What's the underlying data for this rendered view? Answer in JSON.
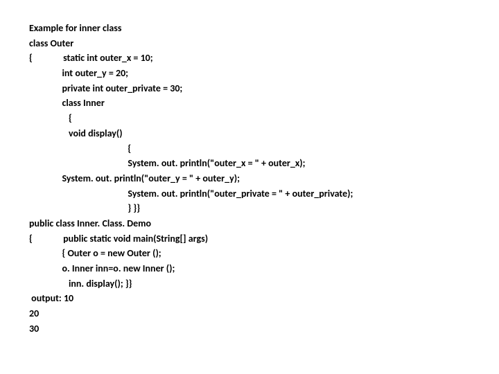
{
  "lines": [
    {
      "text": "Example for inner class",
      "indent": 0
    },
    {
      "text": "class Outer",
      "indent": 0
    },
    {
      "prefix": "{",
      "text": "static int outer_x = 10;",
      "indent": 1
    },
    {
      "text": "int outer_y = 20;",
      "indent": 1
    },
    {
      "text": "private int outer_private = 30;",
      "indent": 1
    },
    {
      "text": "class Inner",
      "indent": 1
    },
    {
      "text": "   {",
      "indent": 1
    },
    {
      "text": "   void display()",
      "indent": 1
    },
    {
      "text": "{",
      "indent": 3
    },
    {
      "text": "System. out. println(\"outer_x = \" + outer_x);",
      "indent": 3
    },
    {
      "text": "System. out. println(\"outer_y = \" + outer_y);",
      "indent": 1
    },
    {
      "text": "System. out. println(\"outer_private = \" + outer_private);",
      "indent": 3
    },
    {
      "text": "} }}",
      "indent": 3
    },
    {
      "text": "public class Inner. Class. Demo",
      "indent": 0
    },
    {
      "prefix": "{",
      "text": "public static void main(String[] args)",
      "indent": 1
    },
    {
      "text": "{ Outer o = new Outer ();",
      "indent": 1
    },
    {
      "text": "o. Inner inn=o. new Inner ();",
      "indent": 1
    },
    {
      "text": "   inn. display(); }}",
      "indent": 1
    },
    {
      "text": " output: 10",
      "indent": 0
    },
    {
      "text": "20",
      "indent": 0
    },
    {
      "text": "30",
      "indent": 0
    }
  ],
  "indent_unit": "               "
}
